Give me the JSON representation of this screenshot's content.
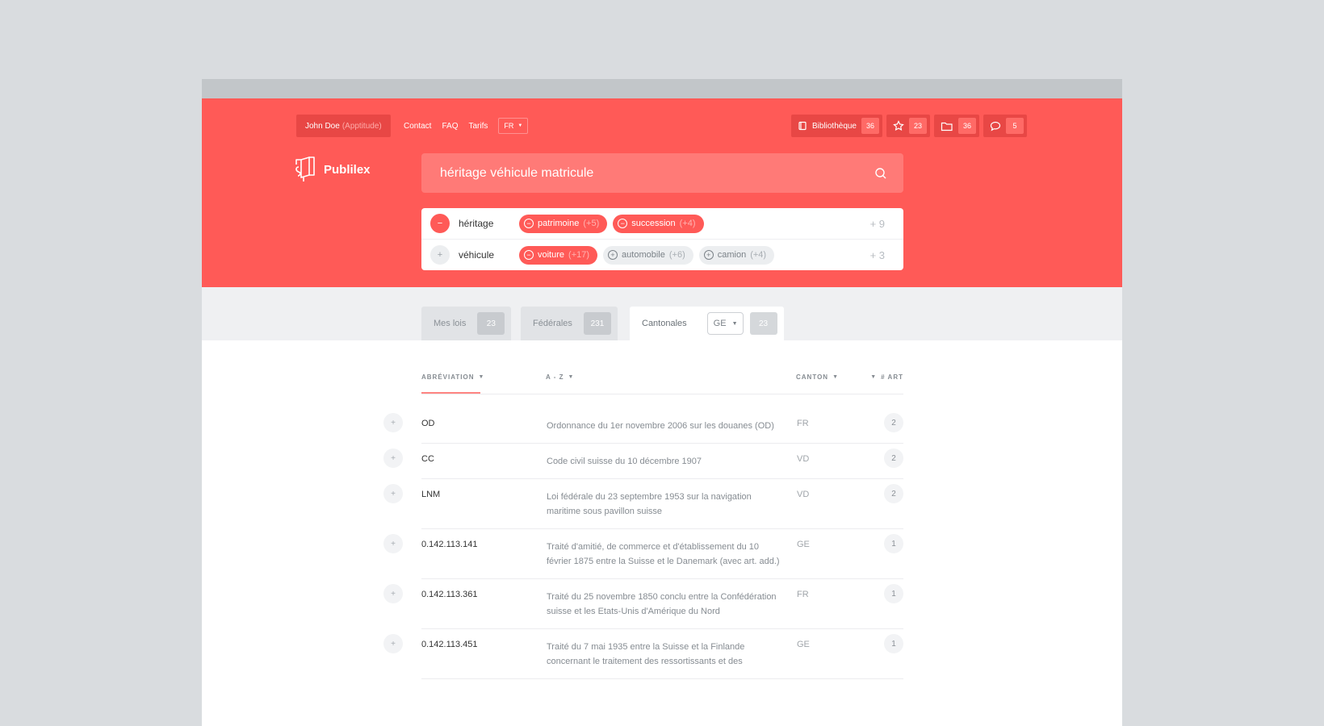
{
  "header": {
    "user": {
      "name": "John Doe",
      "org": "(Apptitude)"
    },
    "nav": [
      "Contact",
      "FAQ",
      "Tarifs"
    ],
    "language": "FR",
    "counters": [
      {
        "icon": "book-icon",
        "label": "Bibliothèque",
        "count": "36"
      },
      {
        "icon": "star-icon",
        "label": "",
        "count": "23"
      },
      {
        "icon": "folder-icon",
        "label": "",
        "count": "36"
      },
      {
        "icon": "chat-icon",
        "label": "",
        "count": "5"
      }
    ],
    "logo": "Publilex"
  },
  "search": {
    "value": "héritage véhicule matricule"
  },
  "keywords": [
    {
      "word": "héritage",
      "toggle": "−",
      "enabled": true,
      "chips": [
        {
          "label": "patrimoine",
          "count": "(+5)",
          "active": true
        },
        {
          "label": "succession",
          "count": "(+4)",
          "active": true
        }
      ],
      "more": "+ 9"
    },
    {
      "word": "véhicule",
      "toggle": "+",
      "enabled": false,
      "chips": [
        {
          "label": "voiture",
          "count": "(+17)",
          "active": true
        },
        {
          "label": "automobile",
          "count": "(+6)",
          "active": false
        },
        {
          "label": "camion",
          "count": "(+4)",
          "active": false
        }
      ],
      "more": "+ 3"
    }
  ],
  "tabs": [
    {
      "label": "Mes lois",
      "count": "23"
    },
    {
      "label": "Fédérales",
      "count": "231"
    },
    {
      "label": "Cantonales",
      "select": "GE",
      "count": "23"
    }
  ],
  "table": {
    "columns": {
      "abbr": "ABRÉVIATION",
      "az": "A - Z",
      "canton": "CANTON",
      "art": "# ART"
    },
    "rows": [
      {
        "abbr": "OD",
        "title": "Ordonnance du 1er novembre 2006 sur les douanes (OD)",
        "canton": "FR",
        "art": "2"
      },
      {
        "abbr": "CC",
        "title": "Code civil suisse du 10 décembre 1907",
        "canton": "VD",
        "art": "2"
      },
      {
        "abbr": "LNM",
        "title": "Loi fédérale du 23 septembre 1953 sur la navigation maritime sous pavillon suisse",
        "canton": "VD",
        "art": "2"
      },
      {
        "abbr": "0.142.113.141",
        "title": "Traité d'amitié, de commerce et d'établissement du 10 février 1875 entre la Suisse et le Danemark (avec art. add.)",
        "canton": "GE",
        "art": "1"
      },
      {
        "abbr": "0.142.113.361",
        "title": "Traité du 25 novembre 1850 conclu entre la Confédération suisse et les Etats-Unis d'Amérique du Nord",
        "canton": "FR",
        "art": "1"
      },
      {
        "abbr": "0.142.113.451",
        "title": "Traité du 7 mai 1935 entre la Suisse et la Finlande concernant le traitement des ressortissants et des",
        "canton": "GE",
        "art": "1"
      }
    ]
  },
  "colors": {
    "brand": "#ff5a57",
    "brand_dark": "#e84745"
  }
}
